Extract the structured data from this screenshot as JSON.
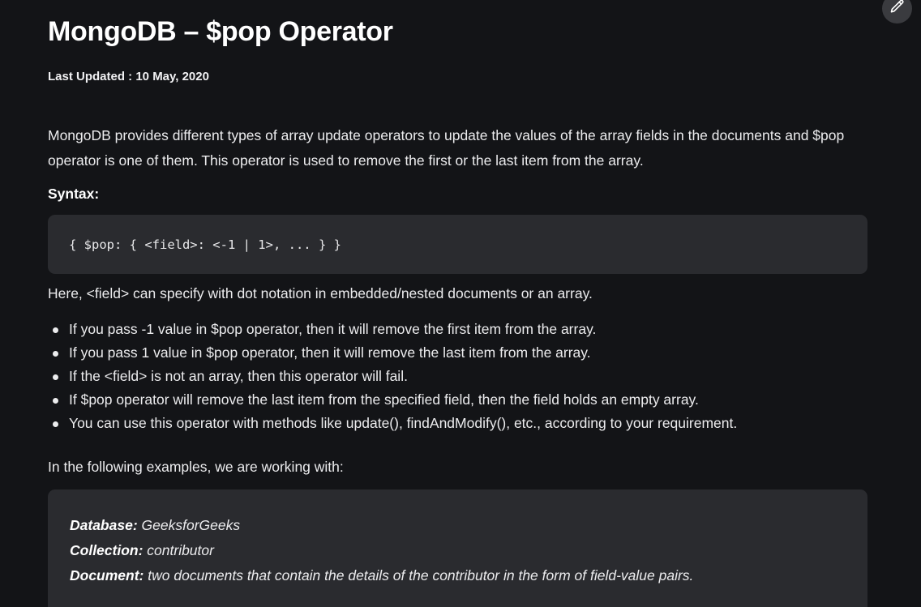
{
  "article": {
    "title": "MongoDB – $pop Operator",
    "last_updated": "Last Updated : 10 May, 2020",
    "intro": "MongoDB provides different types of array update operators to update the values of the array fields in the documents and $pop operator is one of them. This operator is used to remove the first or the last item from the array.",
    "syntax_label": "Syntax:",
    "syntax_code": "{ $pop: { <field>: <-1 | 1>, ... } }",
    "field_note": "Here, <field> can specify with dot notation in embedded/nested documents or an array.",
    "bullets": [
      "If you pass -1 value in $pop operator, then it will remove the first item from the array.",
      "If you pass 1 value in $pop operator, then it will remove the last item from the array.",
      "If the <field> is not an array, then this operator will fail.",
      "If $pop operator will remove the last item from the specified field, then the field holds an empty array.",
      "You can use this operator with methods like update(), findAndModify(), etc., according to your requirement."
    ],
    "examples_intro": "In the following examples, we are working with:",
    "info": {
      "database_label": "Database:",
      "database_value": " GeeksforGeeks",
      "collection_label": "Collection:",
      "collection_value": " contributor",
      "document_label": "Document:",
      "document_value": " two documents that contain the details of the contributor in the form of field-value pairs."
    }
  },
  "edit_button": {
    "icon": "pencil-icon"
  },
  "colors": {
    "background": "#131417",
    "code_background": "#2a2b2f",
    "text": "#ececee"
  }
}
